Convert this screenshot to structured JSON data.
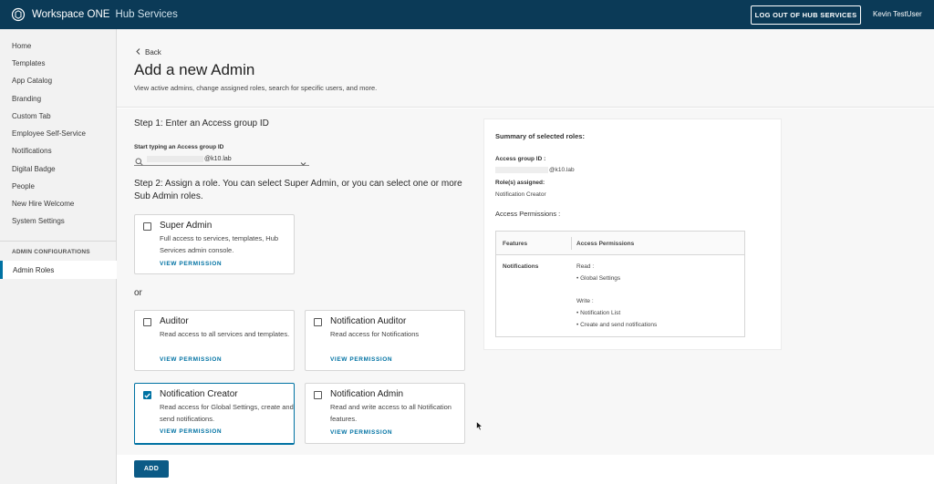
{
  "header": {
    "brand": "Workspace ONE",
    "product": "Hub Services",
    "logout_label": "LOG OUT OF HUB SERVICES",
    "user": "Kevin TestUser"
  },
  "sidebar": {
    "items": [
      {
        "label": "Home"
      },
      {
        "label": "Templates"
      },
      {
        "label": "App Catalog"
      },
      {
        "label": "Branding"
      },
      {
        "label": "Custom Tab"
      },
      {
        "label": "Employee Self-Service"
      },
      {
        "label": "Notifications"
      },
      {
        "label": "Digital Badge"
      },
      {
        "label": "People"
      },
      {
        "label": "New Hire Welcome"
      },
      {
        "label": "System Settings"
      }
    ],
    "section_title": "ADMIN CONFIGURATIONS",
    "active_item": "Admin Roles"
  },
  "page": {
    "back_label": "Back",
    "title": "Add a new Admin",
    "subtitle": "View active admins, change assigned roles, search for specific users, and more.",
    "step1": "Step 1: Enter an Access group ID",
    "field_label": "Start typing an Access group ID",
    "field_value": "@k10.lab",
    "step2": "Step 2: Assign a role. You can select Super Admin, or you can select one or more Sub Admin roles.",
    "or_label": "or",
    "add_label": "ADD"
  },
  "roles": [
    {
      "title": "Super Admin",
      "desc": "Full access to services, templates, Hub Services admin console.",
      "link": "VIEW PERMISSION",
      "checked": false
    },
    {
      "title": "Auditor",
      "desc": "Read access to all services and templates.",
      "link": "VIEW PERMISSION",
      "checked": false
    },
    {
      "title": "Notification Auditor",
      "desc": "Read access for Notifications",
      "link": "VIEW PERMISSION",
      "checked": false
    },
    {
      "title": "Notification Creator",
      "desc": "Read access for Global Settings, create and send notifications.",
      "link": "VIEW PERMISSION",
      "checked": true
    },
    {
      "title": "Notification Admin",
      "desc": "Read and write access to all Notification features.",
      "link": "VIEW PERMISSION",
      "checked": false
    }
  ],
  "summary": {
    "title": "Summary of selected roles:",
    "access_group_label": "Access group ID :",
    "access_group_value": "@k10.lab",
    "roles_label": "Role(s) assigned:",
    "roles_value": "Notification Creator",
    "permissions_title": "Access Permissions :",
    "table": {
      "col_features": "Features",
      "col_permissions": "Access Permissions",
      "feature": "Notifications",
      "read_label": "Read :",
      "read_items": [
        "Global Settings"
      ],
      "write_label": "Write :",
      "write_items": [
        "Notification List",
        "Create and send notifications"
      ]
    }
  },
  "colors": {
    "topbar": "#0b3a57",
    "accent": "#0072a3",
    "add_button": "#0b5a86"
  }
}
